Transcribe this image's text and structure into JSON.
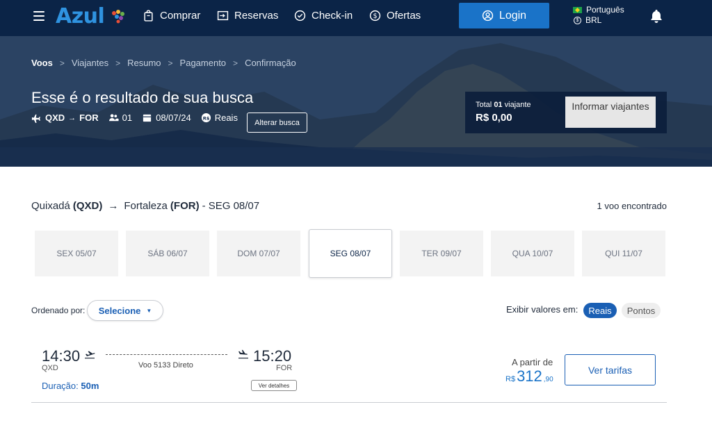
{
  "brand": {
    "name": "Azul"
  },
  "nav": {
    "items": [
      "Comprar",
      "Reservas",
      "Check-in",
      "Ofertas"
    ],
    "login_label": "Login",
    "language": "Português",
    "currency": "BRL"
  },
  "breadcrumb": [
    "Voos",
    "Viajantes",
    "Resumo",
    "Pagamento",
    "Confirmação"
  ],
  "search": {
    "title": "Esse é o resultado de sua busca",
    "origin": "QXD",
    "destination": "FOR",
    "passengers": "01",
    "date": "08/07/24",
    "currency_label": "Reais",
    "change_label": "Alterar busca"
  },
  "summary": {
    "total_prefix": "Total",
    "travelers_count": "01",
    "travelers_suffix": "viajante",
    "total_value": "R$ 0,00",
    "inform_label": "Informar viajantes"
  },
  "results": {
    "origin_city": "Quixadá",
    "origin_code": "(QXD)",
    "destination_city": "Fortaleza",
    "destination_code": "(FOR)",
    "date_label": "- SEG 08/07",
    "found_count": "1 voo encontrado",
    "dates": [
      "SEX 05/07",
      "SÁB 06/07",
      "DOM 07/07",
      "SEG 08/07",
      "TER 09/07",
      "QUA 10/07",
      "QUI 11/07"
    ],
    "selected_date": "SEG 08/07",
    "order_label": "Ordenado por:",
    "order_value": "Selecione",
    "display_label": "Exibir valores em:",
    "display_options": [
      "Reais",
      "Pontos"
    ]
  },
  "flight": {
    "departure_time": "14:30",
    "departure_code": "QXD",
    "arrival_time": "15:20",
    "arrival_code": "FOR",
    "flight_info": "Voo 5133 Direto",
    "duration_label": "Duração:",
    "duration_value": "50m",
    "details_label": "Ver detalhes",
    "price_prefix": "A partir de",
    "price_currency": "R$",
    "price_integer": "312",
    "price_decimals": ",90",
    "fares_label": "Ver tarifas"
  },
  "colors": {
    "navbar": "#0b2447",
    "accent": "#1a73c8",
    "link": "#1a5fb4"
  }
}
